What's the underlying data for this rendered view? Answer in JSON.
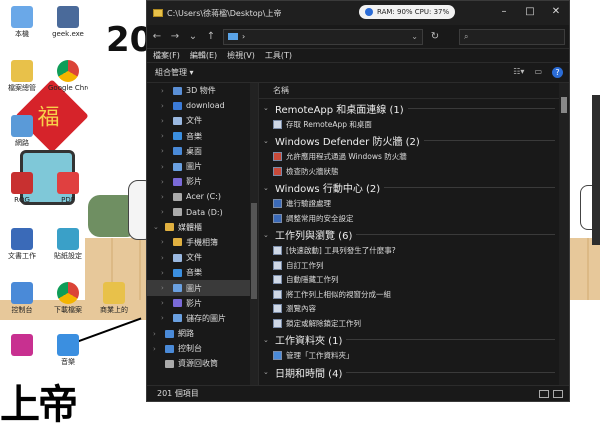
{
  "window": {
    "title": "C:\\Users\\徐蒋楹\\Desktop\\上帝",
    "sysmon": "RAM: 90%  CPU: 37%",
    "close_label": "✕"
  },
  "address": {
    "path": "›",
    "search_placeholder": ""
  },
  "menu": [
    "檔案(F)",
    "編輯(E)",
    "檢視(V)",
    "工具(T)"
  ],
  "toolbar": {
    "organize": "組合管理 ▾"
  },
  "nav": {
    "items": [
      {
        "label": "3D 物件",
        "color": "#5a8fd6"
      },
      {
        "label": "download",
        "color": "#3b7bd8"
      },
      {
        "label": "文件",
        "color": "#9ab8e0"
      },
      {
        "label": "音樂",
        "color": "#3b8fe0"
      },
      {
        "label": "桌面",
        "color": "#4a8ad8"
      },
      {
        "label": "圖片",
        "color": "#6aa0e0"
      },
      {
        "label": "影片",
        "color": "#7a6ad8"
      },
      {
        "label": "Acer (C:)",
        "color": "#aaaaaa"
      },
      {
        "label": "Data (D:)",
        "color": "#aaaaaa"
      },
      {
        "label": "媒體櫃",
        "color": "#e0b040"
      },
      {
        "label": "手機相簿",
        "color": "#e0b040"
      },
      {
        "label": "文件",
        "color": "#9ab8e0"
      },
      {
        "label": "音樂",
        "color": "#3b8fe0"
      },
      {
        "label": "圖片",
        "color": "#6aa0e0"
      },
      {
        "label": "影片",
        "color": "#7a6ad8"
      },
      {
        "label": "儲存的圖片",
        "color": "#6aa0e0"
      },
      {
        "label": "網路",
        "color": "#4a8ad8"
      },
      {
        "label": "控制台",
        "color": "#4a8ad8"
      },
      {
        "label": "資源回收筒",
        "color": "#aaaaaa"
      }
    ],
    "selected_index": 13
  },
  "content": {
    "column_header": "名稱",
    "groups": [
      {
        "title": "RemoteApp 和桌面連線 (1)",
        "items": [
          "存取 RemoteApp 和桌面"
        ]
      },
      {
        "title": "Windows Defender 防火牆 (2)",
        "items": [
          "允許應用程式通過 Windows 防火牆",
          "檢查防火牆狀態"
        ]
      },
      {
        "title": "Windows 行動中心 (2)",
        "items": [
          "進行驗證處理",
          "調整常用的安全設定"
        ]
      },
      {
        "title": "工作列與瀏覽 (6)",
        "items": [
          "[快速啟動] 工具列發生了什麼事?",
          "自訂工作列",
          "自動隱藏工作列",
          "將工作列上相似的視窗分成一組",
          "瀏覽內容",
          "鎖定或解除鎖定工作列"
        ]
      },
      {
        "title": "工作資料夾 (1)",
        "items": [
          "管理「工作資料夾」"
        ]
      },
      {
        "title": "日期和時間 (4)",
        "items": []
      }
    ]
  },
  "status": {
    "count": "201 個項目"
  },
  "desktop": {
    "icons": [
      {
        "label": "本機"
      },
      {
        "label": "geek.exe"
      },
      {
        "label": "檔案總管"
      },
      {
        "label": "Google Chrome"
      },
      {
        "label": "網路"
      },
      {
        "label": "ROG"
      },
      {
        "label": "PDF"
      },
      {
        "label": "文書工作"
      },
      {
        "label": "貼紙設定"
      },
      {
        "label": "控制台"
      },
      {
        "label": "下載檔案"
      },
      {
        "label": "商業上的"
      },
      {
        "label": "音樂"
      }
    ],
    "year_fragment": "20",
    "scrawl": "上帝"
  }
}
